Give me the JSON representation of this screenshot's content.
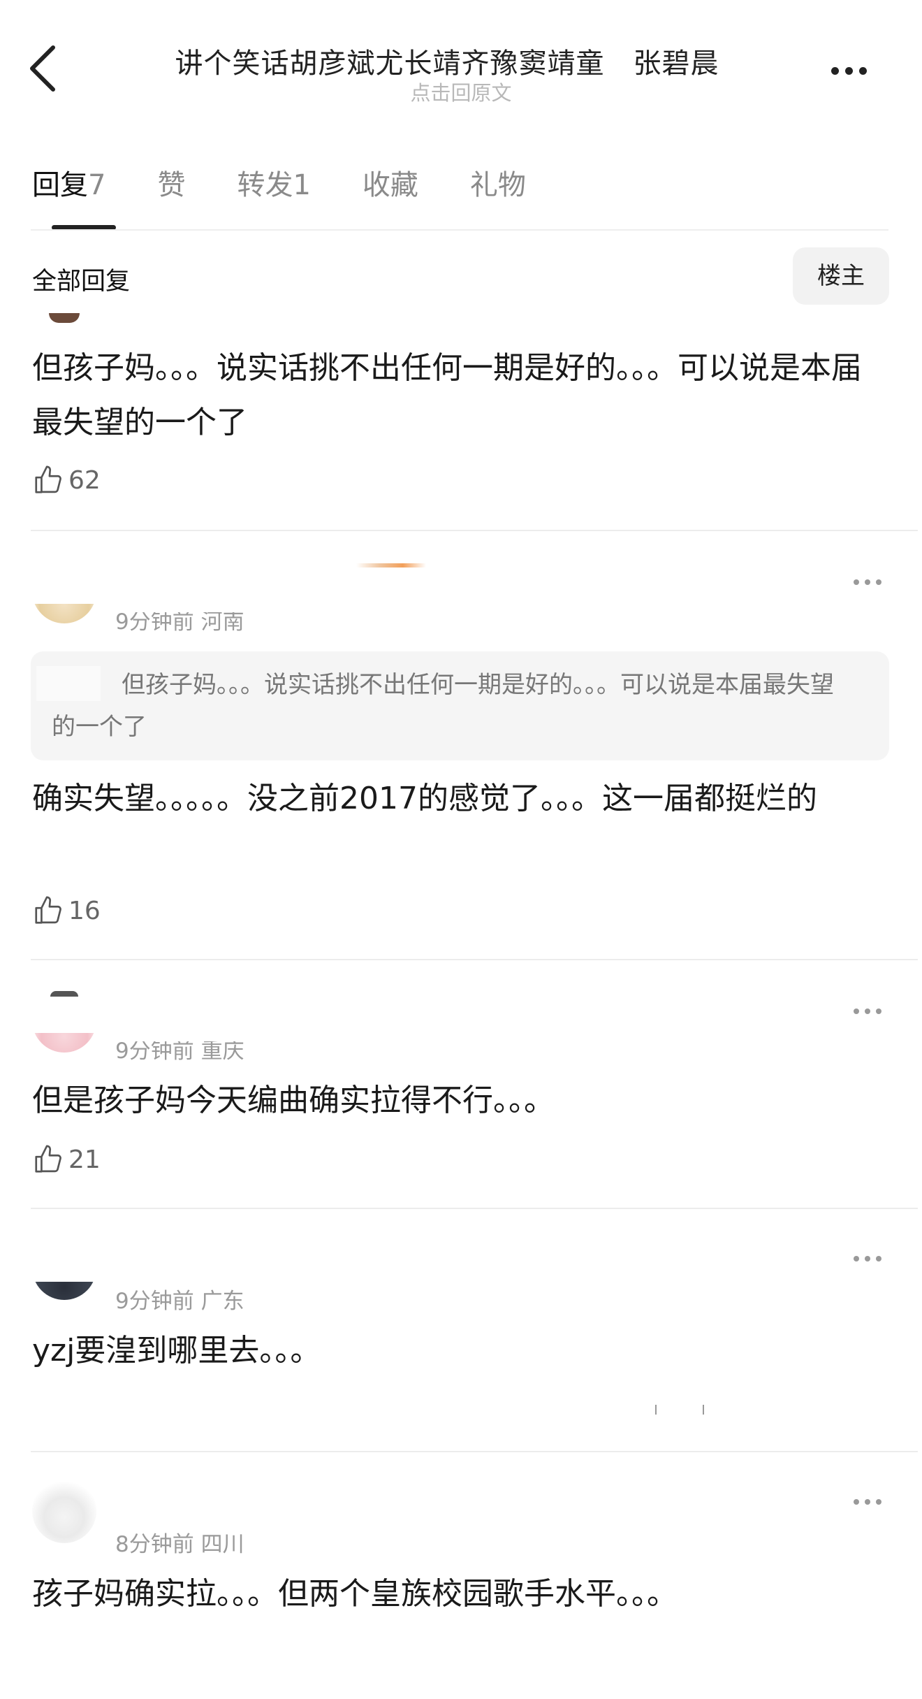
{
  "header": {
    "title": "讲个笑话胡彦斌尤长靖齐豫窦靖童　张碧晨",
    "subtitle": "点击回原文"
  },
  "tabs": [
    {
      "label": "回复",
      "count": "7"
    },
    {
      "label": "赞",
      "count": ""
    },
    {
      "label": "转发",
      "count": "1"
    },
    {
      "label": "收藏",
      "count": ""
    },
    {
      "label": "礼物",
      "count": ""
    }
  ],
  "filter": {
    "label": "全部回复",
    "owner_button": "楼主"
  },
  "comments": [
    {
      "text": "但孩子妈。。。说实话挑不出任何一期是好的。。。可以说是本届最失望的一个了",
      "likes": "62"
    },
    {
      "meta": "9分钟前 河南",
      "quote": "但孩子妈。。。说实话挑不出任何一期是好的。。。可以说是本届最失望的一个了",
      "text": "确实失望。。。。。没之前2017的感觉了。。。这一届都挺烂的",
      "likes": "16"
    },
    {
      "meta": "9分钟前 重庆",
      "text": "但是孩子妈今天编曲确实拉得不行。。。",
      "likes": "21"
    },
    {
      "meta": "9分钟前 广东",
      "text": "yzj要湟到哪里去。。。"
    },
    {
      "meta": "8分钟前 四川",
      "text": "孩子妈确实拉。。。但两个皇族校园歌手水平。。。"
    }
  ],
  "colors": {
    "primary_text": "#1a1a1a",
    "secondary_text": "#9a9a9a",
    "divider": "#ececec",
    "quote_bg": "#f5f5f5"
  }
}
